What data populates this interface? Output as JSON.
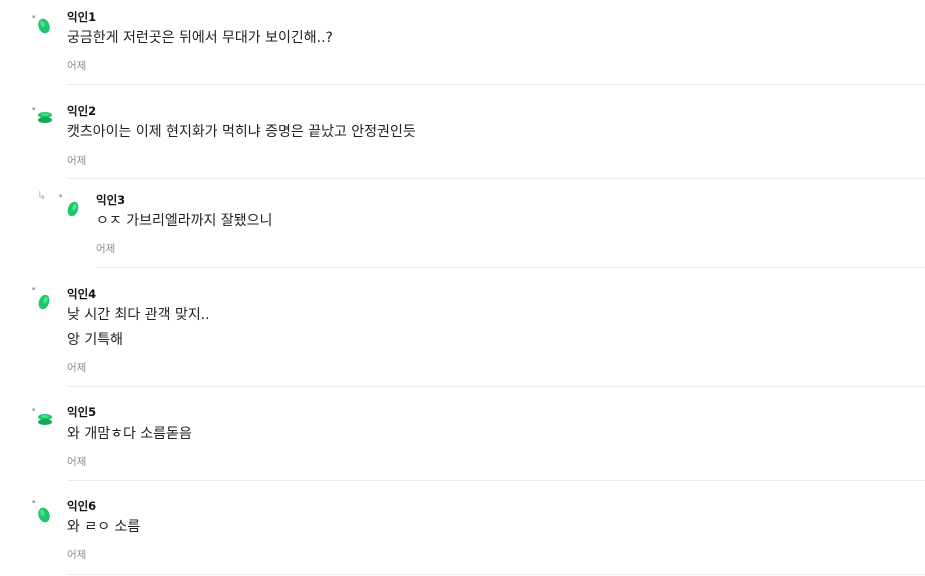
{
  "comments": [
    {
      "author": "익인1",
      "lines": [
        "궁금한게 저런곳은 뒤에서 무대가 보이긴해..?"
      ],
      "date": "어제",
      "avatar": "avatar-bean"
    },
    {
      "author": "익인2",
      "lines": [
        "캣츠아이는 이제 현지화가 먹히냐 증명은 끝났고 안정권인듯"
      ],
      "date": "어제",
      "avatar": "avatar-stack"
    },
    {
      "author": "익인3",
      "lines": [
        "ㅇㅈ 가브리엘라까지 잘됐으니"
      ],
      "date": "어제",
      "avatar": "avatar-bean",
      "is_reply": true
    },
    {
      "author": "익인4",
      "lines": [
        "낮 시간 최다 관객 맞지..",
        "앙 기특해"
      ],
      "date": "어제",
      "avatar": "avatar-bean"
    },
    {
      "author": "익인5",
      "lines": [
        "와 개맘ㅎ다 소름돋음"
      ],
      "date": "어제",
      "avatar": "avatar-stack"
    },
    {
      "author": "익인6",
      "lines": [
        "와 ㄹㅇ 소름"
      ],
      "date": "어제",
      "avatar": "avatar-bean"
    }
  ],
  "reply_icon": "↳",
  "colors": {
    "avatar_green": "#1fc46b",
    "avatar_green_dark": "#12a85a",
    "divider": "#ececec",
    "date": "#8c8c8c"
  }
}
